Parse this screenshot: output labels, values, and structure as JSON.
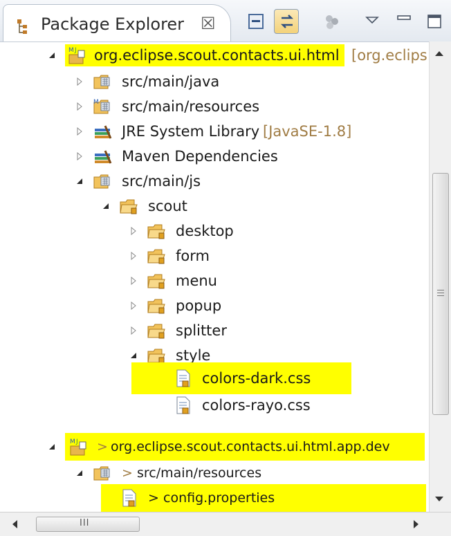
{
  "view": {
    "title": "Package Explorer",
    "close_glyph": "☒"
  },
  "toolbar": {
    "collapse_all_icon": "collapse-all-icon",
    "link_editor_icon": "link-with-editor-icon",
    "focus_icon": "focus-icon",
    "view_menu_icon": "view-menu-icon",
    "minimize_icon": "minimize-icon",
    "maximize_icon": "maximize-icon"
  },
  "tree": {
    "project": {
      "name": "org.eclipse.scout.contacts.ui.html",
      "decoration": "[org.eclips"
    },
    "src_main_java": "src/main/java",
    "src_main_resources": "src/main/resources",
    "jre": {
      "name": "JRE System Library",
      "decoration": "[JavaSE-1.8]"
    },
    "maven": "Maven Dependencies",
    "src_main_js": "src/main/js",
    "scout": "scout",
    "desktop": "desktop",
    "form": "form",
    "menu": "menu",
    "popup": "popup",
    "splitter": "splitter",
    "style": "style",
    "colors_dark": "colors-dark.css",
    "colors_rayo": "colors-rayo.css"
  },
  "tree2": {
    "project": {
      "prefix": ">",
      "name": "org.eclipse.scout.contacts.ui.html.app.dev"
    },
    "resources": {
      "prefix": ">",
      "name": "src/main/resources"
    },
    "config": {
      "prefix": ">",
      "name": "config.properties"
    }
  },
  "scrollbar": {
    "h_grip": "III"
  },
  "colors": {
    "highlight": "#ffff00",
    "decoration": "#a07c44"
  }
}
